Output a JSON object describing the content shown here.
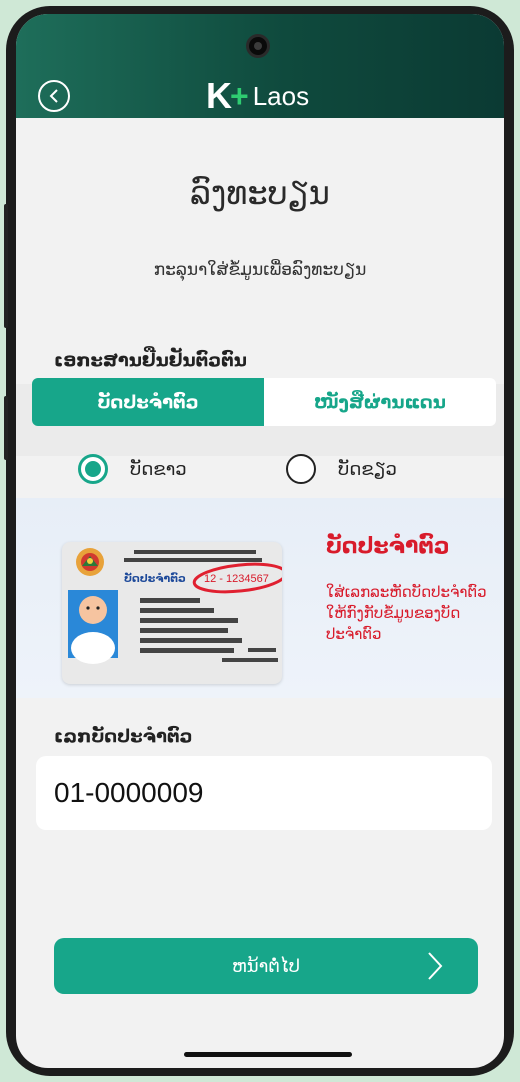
{
  "header": {
    "logo": {
      "k": "K",
      "plus": "+",
      "text": "Laos"
    },
    "back_icon": "circle-chevron-left-icon"
  },
  "page": {
    "title": "ລົງທະບຽນ",
    "subtitle": "ກະລຸນາໃສ່ຂໍ້ມູນເພື່ອລົງທະບຽນ"
  },
  "doc_section": {
    "label": "ເອກະສານຢືນຢັນຕົວຕົນ",
    "tabs": [
      {
        "label": "ບັດປະຈຳຕົວ",
        "active": true
      },
      {
        "label": "ໜັງສືຜ່ານແດນ",
        "active": false
      }
    ]
  },
  "card_color": {
    "options": [
      {
        "label": "ບັດຂາວ",
        "selected": true
      },
      {
        "label": "ບັດຂຽວ",
        "selected": false
      }
    ]
  },
  "example": {
    "card_label": "ບັດປະຈຳຕົວ",
    "card_number": "12 - 1234567",
    "title": "ບັດປະຈຳຕົວ",
    "description": "ໃສ່ເລກລະຫັດບັດປະຈຳຕົວໃຫ້ກົງກັບຂໍ້ມູນຂອງບັດປະຈຳຕົວ",
    "highlight_color": "#d81b2b"
  },
  "id_field": {
    "label": "ເລກບັດປະຈຳຕົວ",
    "value": "01-0000009"
  },
  "next_button": {
    "label": "ຫນ້າຕໍ່ໄປ",
    "icon": "chevron-right-icon"
  },
  "colors": {
    "primary": "#17a68a",
    "header": "#0f4a3d",
    "background": "#f2f2f2"
  }
}
